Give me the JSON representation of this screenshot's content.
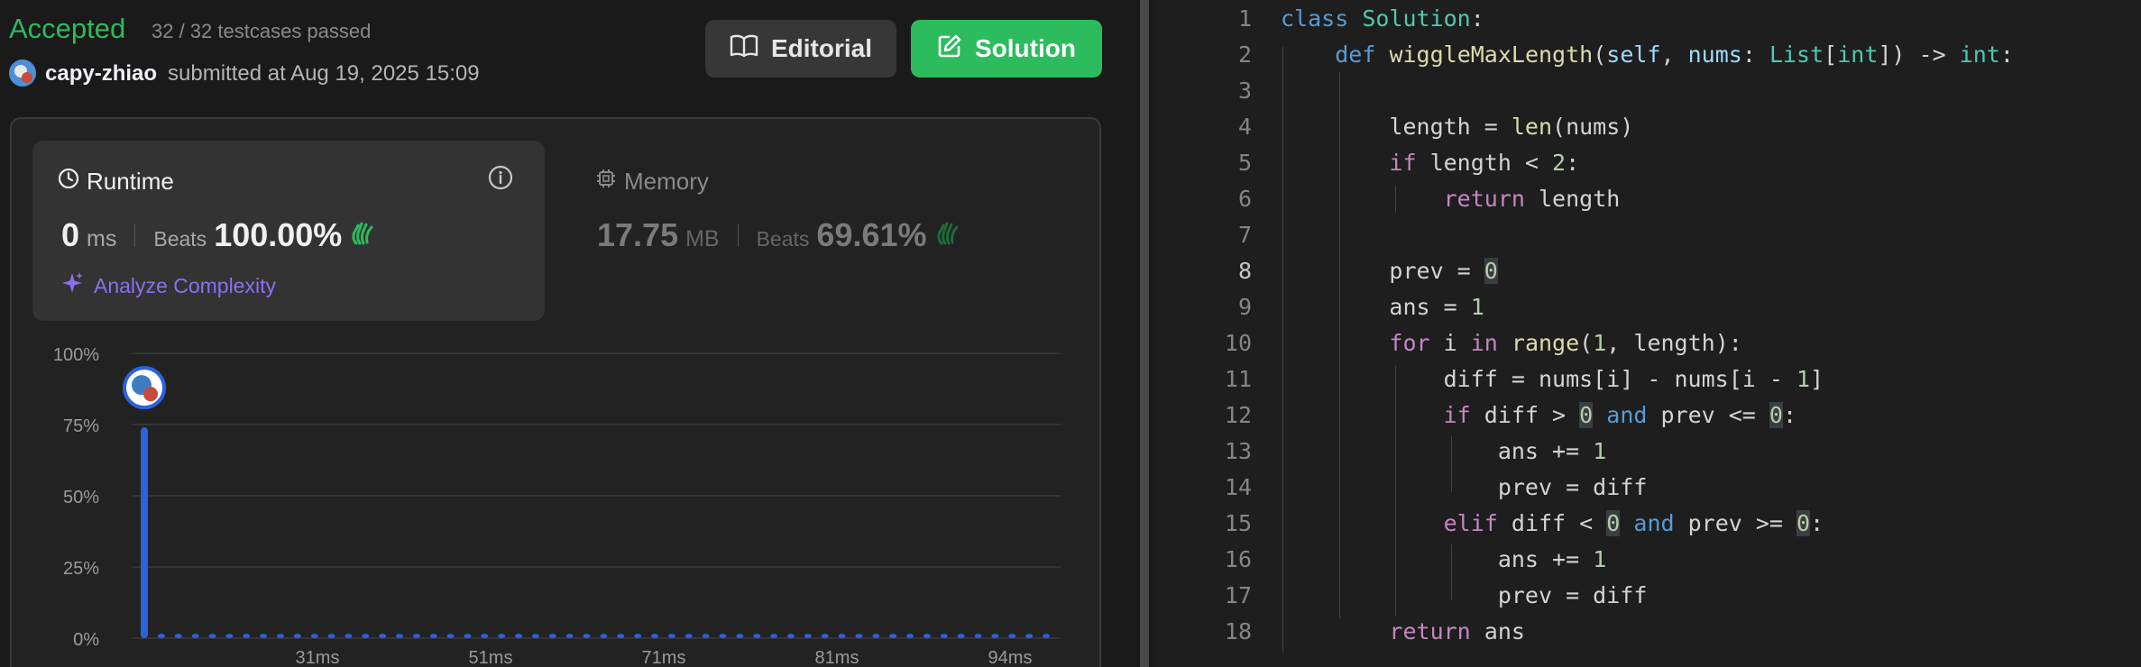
{
  "submission": {
    "status": "Accepted",
    "testcases": "32 / 32 testcases passed",
    "username": "capy-zhiao",
    "submitted_text": "submitted at Aug 19, 2025 15:09"
  },
  "buttons": {
    "editorial": "Editorial",
    "solution": "Solution"
  },
  "runtime": {
    "title": "Runtime",
    "value": "0",
    "unit": "ms",
    "beats_label": "Beats",
    "beats_pct": "100.00%",
    "analyze": "Analyze Complexity"
  },
  "memory": {
    "title": "Memory",
    "value": "17.75",
    "unit": "MB",
    "beats_label": "Beats",
    "beats_pct": "69.61%"
  },
  "colors": {
    "accepted": "#2cbb5d",
    "bar": "#2a62e0",
    "analyze": "#8b6ff0"
  },
  "chart_data": {
    "type": "bar",
    "y_ticks": [
      "100%",
      "75%",
      "50%",
      "25%",
      "0%"
    ],
    "x_ticks": [
      "31ms",
      "51ms",
      "71ms",
      "81ms",
      "94ms"
    ],
    "ylim": [
      0,
      100
    ],
    "highlight_value": 74,
    "highlight_index": 0,
    "bar_count": 54,
    "small_value": 1.5
  },
  "code": {
    "line_numbers": [
      "1",
      "2",
      "3",
      "4",
      "5",
      "6",
      "7",
      "8",
      "9",
      "10",
      "11",
      "12",
      "13",
      "14",
      "15",
      "16",
      "17",
      "18"
    ],
    "active_line": 8
  }
}
